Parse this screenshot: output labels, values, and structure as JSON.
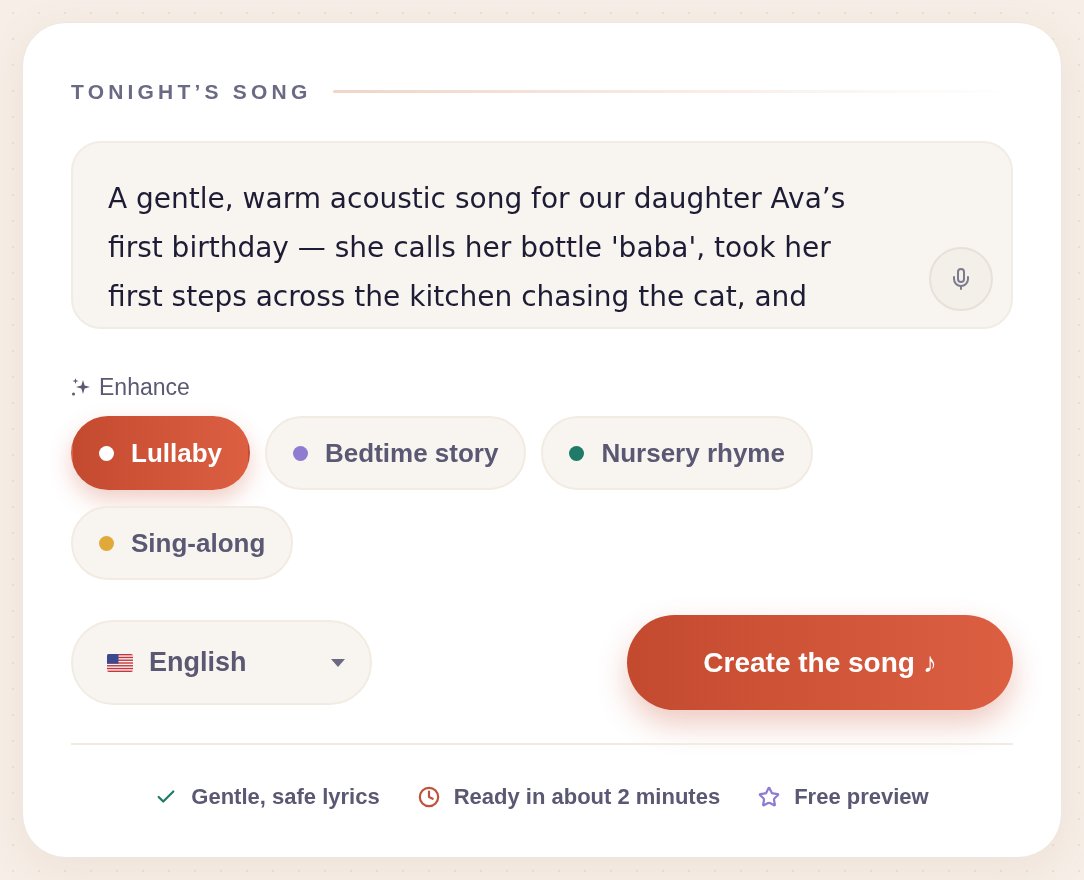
{
  "section": {
    "title": "TONIGHT’S SONG"
  },
  "prompt": {
    "value": "A gentle, warm acoustic song for our daughter Ava’s first birthday — she calls her bottle 'baba', took her first steps across the kitchen chasing the cat, and"
  },
  "enhance": {
    "label": "Enhance"
  },
  "styles": [
    {
      "label": "Lullaby",
      "selected": true,
      "color": "#ffffff"
    },
    {
      "label": "Bedtime story",
      "selected": false,
      "color": "#8f7bd0"
    },
    {
      "label": "Nursery rhyme",
      "selected": false,
      "color": "#1f7a68"
    },
    {
      "label": "Sing-along",
      "selected": false,
      "color": "#e0a93a"
    }
  ],
  "language": {
    "value": "English"
  },
  "create_button": {
    "label": "Create the song ♪"
  },
  "footer": [
    {
      "kind": "check",
      "label": "Gentle, safe lyrics"
    },
    {
      "kind": "clock",
      "label": "Ready in about 2 minutes"
    },
    {
      "kind": "star",
      "label": "Free preview"
    }
  ]
}
